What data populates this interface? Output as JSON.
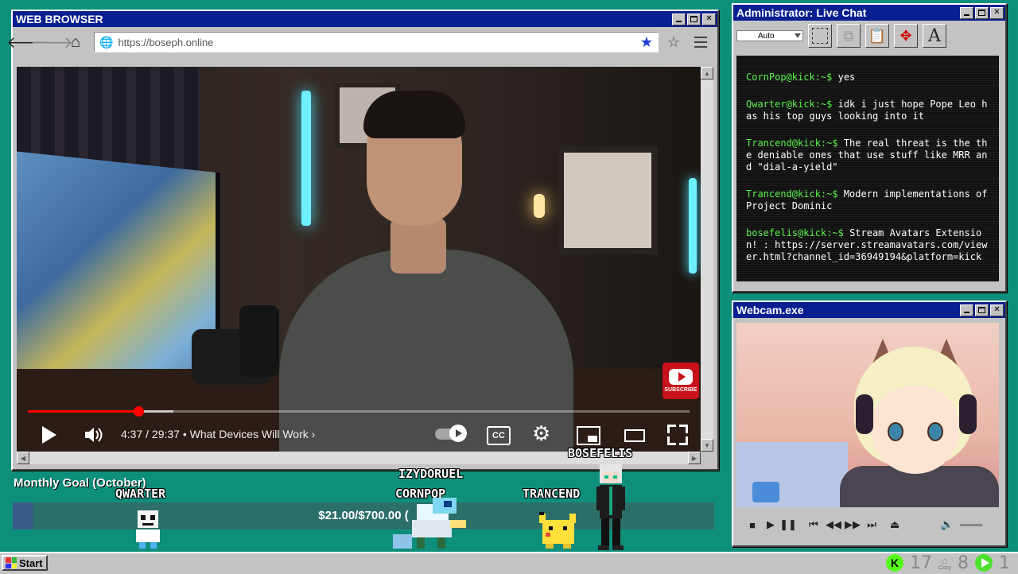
{
  "browser": {
    "title": "WEB BROWSER",
    "url": "https://boseph.online",
    "icons": {
      "back": "arrow-left-icon",
      "forward": "arrow-right-icon",
      "home": "home-icon",
      "bookmark": "star-icon",
      "menu": "hamburger-icon"
    }
  },
  "video": {
    "time_current": "4:37",
    "time_total": "29:37",
    "time_display": "4:37 / 29:37",
    "chapter": "What Devices Will Work",
    "progress": 0.167,
    "buffered": 0.22,
    "subscribe_label": "SUBSCRIBE",
    "accent_color": "#ff0000"
  },
  "chat": {
    "title": "Administrator: Live Chat",
    "font_select": "Auto",
    "messages": [
      {
        "user": "CornPop@kick:~$",
        "text": "yes"
      },
      {
        "user": "Qwarter@kick:~$",
        "text": "idk i just hope Pope Leo has his top guys looking into it"
      },
      {
        "user": "Trancend@kick:~$",
        "text": "The real threat is the the deniable ones that use stuff like MRR and \"dial-a-yield\""
      },
      {
        "user": "Trancend@kick:~$",
        "text": "Modern implementations of Project Dominic"
      },
      {
        "user": "bosefelis@kick:~$",
        "text": "Stream Avatars Extension! : https://server.streamavatars.com/viewer.html?channel_id=36949194&platform=kick"
      }
    ],
    "name_color": "#5cf34c"
  },
  "webcam": {
    "title": "Webcam.exe"
  },
  "overlay": {
    "goal_label": "Monthly Goal (October)",
    "goal_amount": "$21.00/$700.00 (",
    "goal_fraction": 0.03,
    "avatars": [
      {
        "name": "QWARTER"
      },
      {
        "name": "IZYDORUEL"
      },
      {
        "name": "CORNPOP"
      },
      {
        "name": "TRANCEND"
      },
      {
        "name": "BOSEFELIS"
      }
    ]
  },
  "taskbar": {
    "start_label": "Start",
    "tray": {
      "kick_count": "17",
      "cozy_label": "Cozy",
      "cozy_count": "8",
      "rumble_count": "1"
    }
  }
}
